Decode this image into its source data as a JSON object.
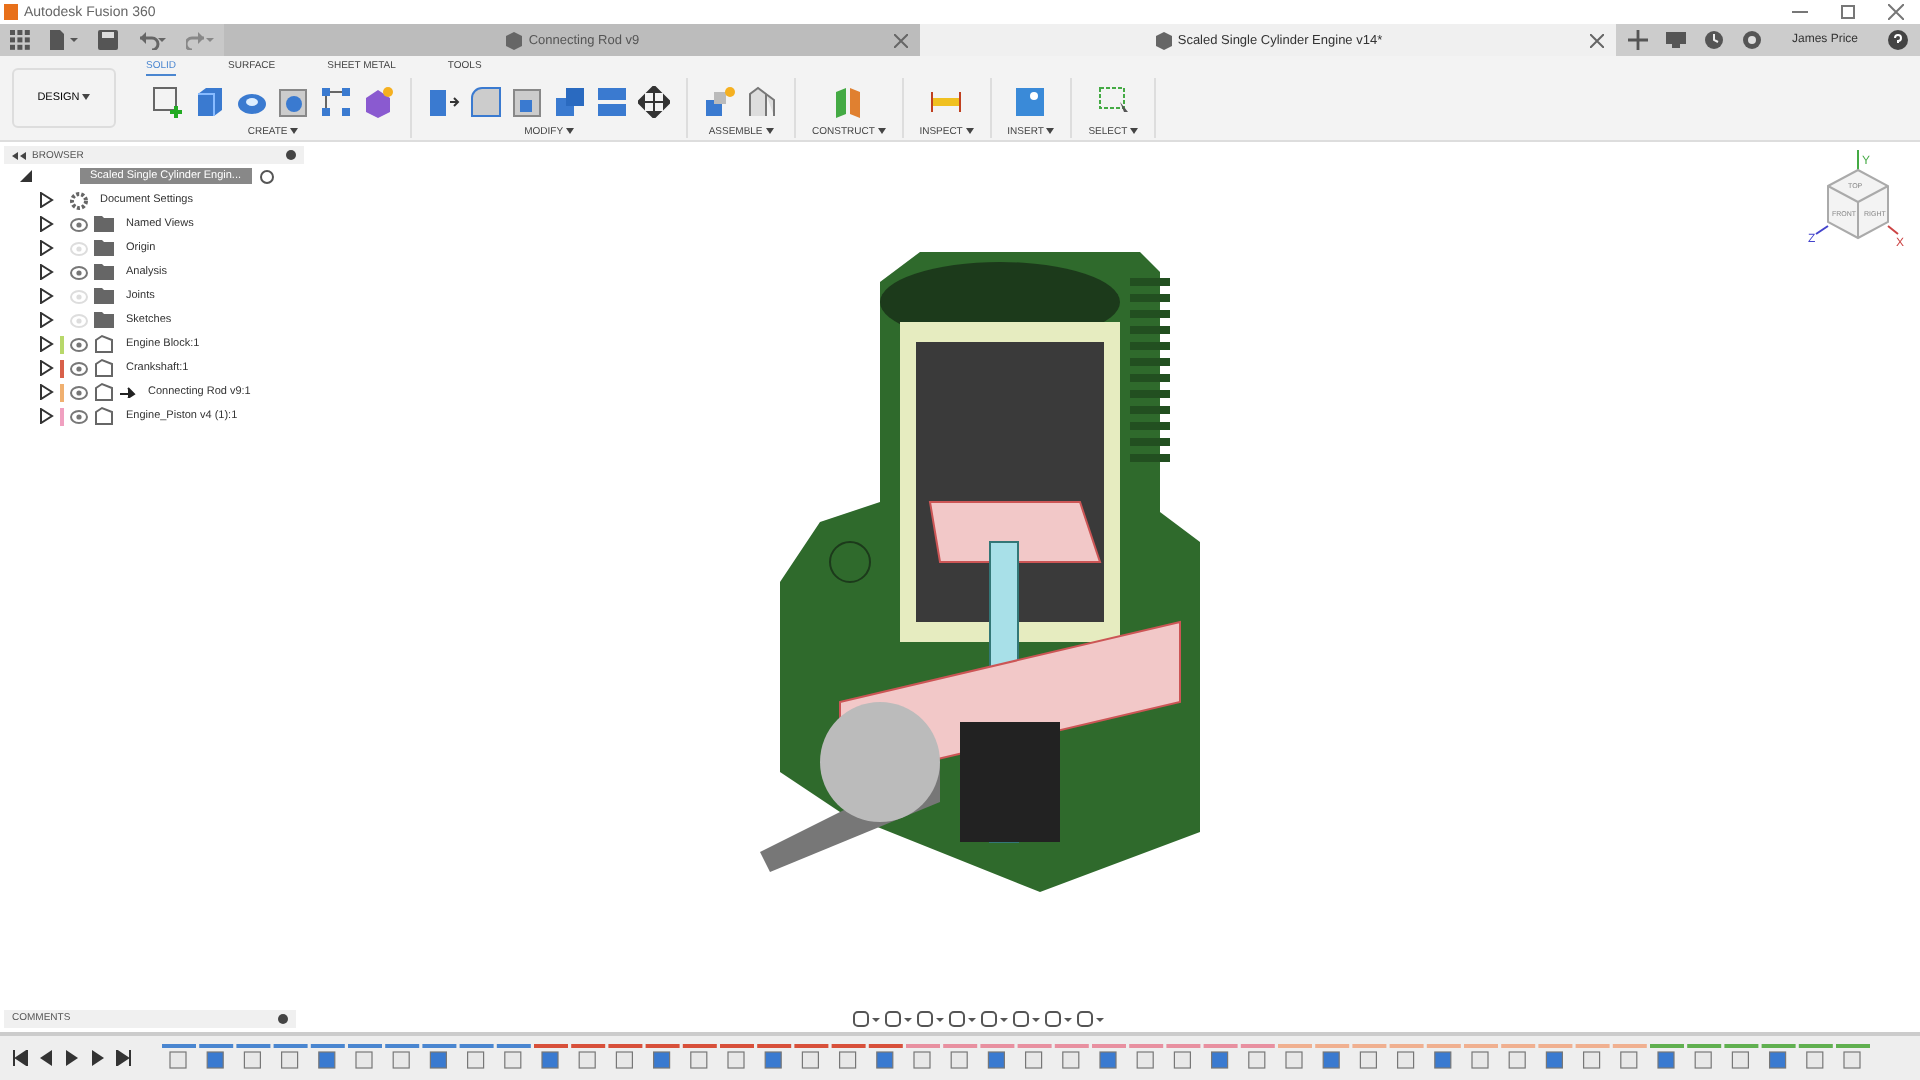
{
  "window": {
    "title": "Autodesk Fusion 360"
  },
  "tabs": [
    {
      "label": "Connecting Rod v9",
      "selected": false
    },
    {
      "label": "Scaled Single Cylinder Engine v14*",
      "selected": true
    }
  ],
  "user": {
    "name": "James Price"
  },
  "workspace": {
    "label": "DESIGN"
  },
  "ribbon_tabs": [
    {
      "label": "SOLID",
      "selected": true
    },
    {
      "label": "SURFACE",
      "selected": false
    },
    {
      "label": "SHEET METAL",
      "selected": false
    },
    {
      "label": "TOOLS",
      "selected": false
    }
  ],
  "ribbon_groups": [
    {
      "label": "CREATE",
      "tools": [
        {
          "kind": "sketch"
        },
        {
          "kind": "box"
        },
        {
          "kind": "revolve"
        },
        {
          "kind": "hole"
        },
        {
          "kind": "pattern"
        },
        {
          "kind": "form"
        }
      ]
    },
    {
      "label": "MODIFY",
      "tools": [
        {
          "kind": "presspull"
        },
        {
          "kind": "fillet"
        },
        {
          "kind": "shell"
        },
        {
          "kind": "combine"
        },
        {
          "kind": "offset"
        },
        {
          "kind": "move"
        }
      ]
    },
    {
      "label": "ASSEMBLE",
      "tools": [
        {
          "kind": "component"
        },
        {
          "kind": "joint"
        }
      ]
    },
    {
      "label": "CONSTRUCT",
      "tools": [
        {
          "kind": "plane"
        }
      ]
    },
    {
      "label": "INSPECT",
      "tools": [
        {
          "kind": "measure"
        }
      ]
    },
    {
      "label": "INSERT",
      "tools": [
        {
          "kind": "image"
        }
      ]
    },
    {
      "label": "SELECT",
      "tools": [
        {
          "kind": "select"
        }
      ]
    }
  ],
  "browser": {
    "title": "BROWSER",
    "root": "Scaled Single Cylinder Engin...",
    "items": [
      {
        "label": "Document Settings",
        "kind": "settings"
      },
      {
        "label": "Named Views",
        "kind": "folder",
        "visible": true
      },
      {
        "label": "Origin",
        "kind": "folder",
        "visible": false
      },
      {
        "label": "Analysis",
        "kind": "folder",
        "visible": true
      },
      {
        "label": "Joints",
        "kind": "folder",
        "visible": false
      },
      {
        "label": "Sketches",
        "kind": "folder",
        "visible": false
      },
      {
        "label": "Engine Block:1",
        "kind": "component",
        "visible": true,
        "color": "#b8d86a"
      },
      {
        "label": "Crankshaft:1",
        "kind": "component",
        "visible": true,
        "color": "#d8604a"
      },
      {
        "label": "Connecting Rod v9:1",
        "kind": "linked",
        "visible": true,
        "color": "#f0b070"
      },
      {
        "label": "Engine_Piston v4 (1):1",
        "kind": "component",
        "visible": true,
        "color": "#f0a0c0"
      }
    ]
  },
  "viewcube": {
    "top": "TOP",
    "front": "FRONT",
    "right": "RIGHT",
    "x": "X",
    "y": "Y",
    "z": "Z"
  },
  "comments": {
    "title": "COMMENTS"
  }
}
